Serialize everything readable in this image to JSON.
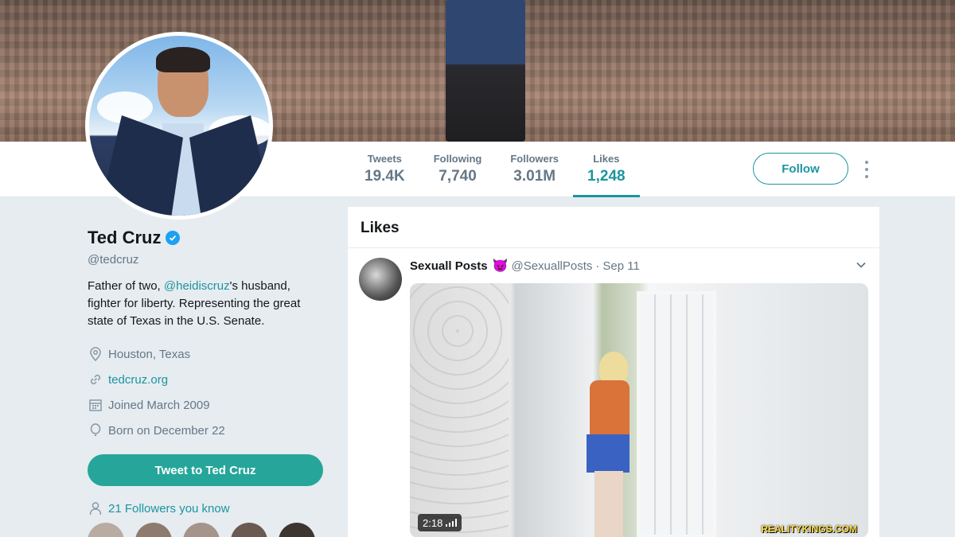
{
  "profile": {
    "name": "Ted Cruz",
    "handle": "@tedcruz",
    "bio_before": "Father of two, ",
    "bio_mention": "@heidiscruz",
    "bio_after": "'s husband, fighter for liberty. Representing the great state of Texas in the U.S. Senate.",
    "location": "Houston, Texas",
    "website": "tedcruz.org",
    "joined": "Joined March 2009",
    "born": "Born on December 22",
    "tweet_to_label": "Tweet to Ted Cruz",
    "followers_you_know": "21 Followers you know"
  },
  "stats": [
    {
      "label": "Tweets",
      "value": "19.4K"
    },
    {
      "label": "Following",
      "value": "7,740"
    },
    {
      "label": "Followers",
      "value": "3.01M"
    },
    {
      "label": "Likes",
      "value": "1,248"
    }
  ],
  "active_tab": "Likes",
  "follow_label": "Follow",
  "feed": {
    "title": "Likes",
    "tweet": {
      "author": "Sexuall Posts",
      "emoji": "😈",
      "handle": "@SexuallPosts",
      "separator": "·",
      "date": "Sep 11",
      "duration": "2:18",
      "watermark": "REALITYKINGS.COM"
    }
  },
  "colors": {
    "accent": "#1b95a0",
    "button": "#26a69a",
    "verified": "#1da1f2",
    "background": "#e6ecf0"
  }
}
